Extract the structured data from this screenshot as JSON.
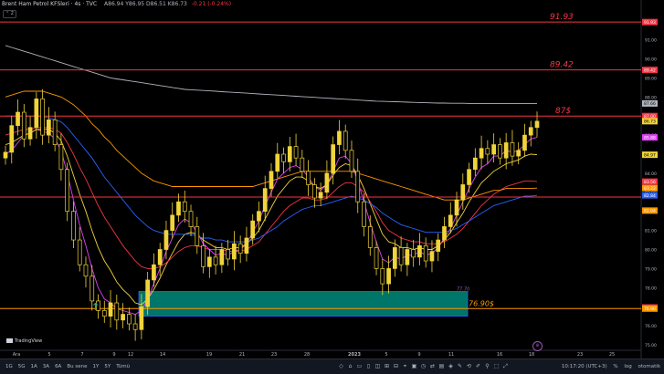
{
  "header": {
    "title": "Brent Ham Petrol KFSleri · 4s · TVC",
    "open": "A86.94",
    "high": "Y86.95",
    "low": "D86.51",
    "close": "K86.73",
    "change": "-0.21 (-0.24%)",
    "collapse_label": "⌃ 2"
  },
  "chart_data": {
    "type": "candlestick",
    "ylim": [
      75.0,
      92.8
    ],
    "price_axis_ticks": [
      "92.00",
      "91.00",
      "90.00",
      "89.00",
      "88.00",
      "87.00",
      "86.00",
      "85.00",
      "84.00",
      "83.00",
      "82.00",
      "81.00",
      "80.00",
      "79.00",
      "78.00",
      "77.00",
      "76.00",
      "75.00"
    ],
    "x_ticks": [
      "Ara",
      "5",
      "7",
      "9",
      "12",
      "14",
      "19",
      "21",
      "23",
      "28",
      "2023",
      "5",
      "9",
      "11",
      "16",
      "18",
      "23",
      "25"
    ],
    "price_tags": [
      {
        "label": "91.93",
        "value": 91.93,
        "color": "#f23645"
      },
      {
        "label": "89.42",
        "value": 89.42,
        "color": "#f23645"
      },
      {
        "label": "87.66",
        "value": 87.66,
        "color": "#b2b5be"
      },
      {
        "label": "87.00",
        "value": 87.0,
        "color": "#f23645"
      },
      {
        "label": "86.73",
        "value": 86.73,
        "color": "#f0d43a"
      },
      {
        "label": "85.88",
        "value": 85.88,
        "color": "#e040fb"
      },
      {
        "label": "84.97",
        "value": 84.97,
        "color": "#f0d43a"
      },
      {
        "label": "83.56",
        "value": 83.56,
        "color": "#f23645"
      },
      {
        "label": "83.22",
        "value": 83.22,
        "color": "#ff9800"
      },
      {
        "label": "82.84",
        "value": 82.84,
        "color": "#2962ff"
      },
      {
        "label": "82.04",
        "value": 82.04,
        "color": "#ff9800"
      },
      {
        "label": "76.96",
        "value": 76.96,
        "color": "#f23645"
      },
      {
        "label": "76.90",
        "value": 76.9,
        "color": "#ff9800"
      }
    ],
    "horizontal_levels": [
      {
        "value": 91.93,
        "color": "#f23645",
        "label": "91.93"
      },
      {
        "value": 89.42,
        "color": "#f23645",
        "label": "89.42"
      },
      {
        "value": 87.0,
        "color": "#f23645",
        "label": "87$"
      },
      {
        "value": 82.75,
        "color": "#f23645",
        "label": ""
      },
      {
        "value": 76.9,
        "color": "#ff9800",
        "label": "76.90$"
      }
    ],
    "zone": {
      "from": 76.5,
      "to": 77.8,
      "label": "77.70",
      "color": "#00897b"
    },
    "closes": [
      85.1,
      86.5,
      87.2,
      85.8,
      86.4,
      87.9,
      86.0,
      86.8,
      85.5,
      84.2,
      82.0,
      80.5,
      79.2,
      78.6,
      77.3,
      76.8,
      76.5,
      77.2,
      76.3,
      76.6,
      76.1,
      75.8,
      77.0,
      78.4,
      79.2,
      80.0,
      81.0,
      81.8,
      82.5,
      82.0,
      81.2,
      80.2,
      79.1,
      79.6,
      79.2,
      80.0,
      79.5,
      80.3,
      79.8,
      80.6,
      81.5,
      82.0,
      83.2,
      84.1,
      85.0,
      84.6,
      85.4,
      84.8,
      84.1,
      83.4,
      82.7,
      83.0,
      84.0,
      85.5,
      86.2,
      85.2,
      84.1,
      82.5,
      81.2,
      80.1,
      79.0,
      78.2,
      79.0,
      80.1,
      79.2,
      80.0,
      79.6,
      80.2,
      79.4,
      79.9,
      80.5,
      81.2,
      81.8,
      82.6,
      83.4,
      84.2,
      84.8,
      85.3,
      85.0,
      85.5,
      84.8,
      85.6,
      84.9,
      85.2,
      86.0,
      86.4,
      86.73
    ],
    "emas": [
      {
        "name": "",
        "color": "#e040fb",
        "values": [
          85.0,
          85.2,
          85.6,
          86.0,
          86.1,
          86.3,
          86.2,
          86.1,
          85.8,
          85.2,
          84.0,
          82.6,
          81.3,
          80.2,
          79.0,
          78.0,
          77.4,
          77.2,
          76.9,
          76.8,
          76.7,
          76.6,
          76.8,
          77.4,
          78.2,
          79.0,
          79.9,
          80.6,
          81.3,
          81.6,
          81.4,
          80.9,
          80.3,
          80.0,
          79.7,
          79.8,
          79.7,
          79.9,
          80.0,
          80.3,
          80.9,
          81.5,
          82.3,
          83.0,
          83.7,
          84.0,
          84.3,
          84.4,
          84.2,
          83.8,
          83.3,
          83.1,
          83.4,
          84.1,
          84.8,
          84.9,
          84.5,
          83.6,
          82.5,
          81.4,
          80.4,
          79.5,
          79.3,
          79.6,
          79.5,
          79.7,
          79.7,
          79.9,
          79.7,
          79.8,
          80.1,
          80.6,
          81.1,
          81.8,
          82.5,
          83.2,
          83.8,
          84.3,
          84.5,
          84.9,
          84.9,
          85.2,
          85.1,
          85.2,
          85.5,
          85.8,
          85.88
        ]
      },
      {
        "name": "",
        "color": "#f0d43a",
        "values": [
          85.5,
          85.6,
          85.8,
          86.0,
          86.1,
          86.3,
          86.3,
          86.3,
          86.1,
          85.7,
          84.9,
          83.9,
          82.9,
          82.0,
          81.0,
          80.1,
          79.4,
          78.9,
          78.3,
          77.9,
          77.6,
          77.2,
          77.1,
          77.4,
          77.9,
          78.5,
          79.2,
          79.8,
          80.4,
          80.8,
          80.9,
          80.8,
          80.5,
          80.3,
          80.1,
          80.1,
          80.0,
          80.1,
          80.1,
          80.3,
          80.6,
          81.0,
          81.6,
          82.2,
          82.8,
          83.2,
          83.6,
          83.8,
          83.8,
          83.6,
          83.3,
          83.2,
          83.4,
          83.9,
          84.3,
          84.5,
          84.4,
          83.9,
          83.2,
          82.4,
          81.6,
          80.8,
          80.4,
          80.3,
          80.1,
          80.1,
          80.0,
          80.1,
          80.0,
          80.0,
          80.2,
          80.5,
          80.9,
          81.4,
          81.9,
          82.5,
          83.0,
          83.5,
          83.8,
          84.1,
          84.3,
          84.5,
          84.6,
          84.7,
          84.9,
          85.0,
          84.97
        ]
      },
      {
        "name": "",
        "color": "#f23645",
        "values": [
          86.0,
          86.1,
          86.2,
          86.3,
          86.3,
          86.4,
          86.4,
          86.4,
          86.3,
          86.1,
          85.6,
          85.0,
          84.3,
          83.7,
          83.0,
          82.3,
          81.7,
          81.2,
          80.7,
          80.2,
          79.8,
          79.4,
          79.1,
          79.0,
          79.0,
          79.1,
          79.3,
          79.6,
          79.9,
          80.1,
          80.2,
          80.2,
          80.1,
          80.0,
          80.0,
          80.0,
          79.9,
          79.9,
          79.9,
          80.0,
          80.2,
          80.4,
          80.8,
          81.2,
          81.6,
          82.0,
          82.3,
          82.5,
          82.7,
          82.7,
          82.6,
          82.6,
          82.7,
          83.0,
          83.3,
          83.5,
          83.5,
          83.3,
          83.0,
          82.5,
          82.0,
          81.4,
          81.0,
          80.8,
          80.6,
          80.5,
          80.4,
          80.4,
          80.3,
          80.3,
          80.3,
          80.4,
          80.6,
          80.8,
          81.1,
          81.5,
          81.9,
          82.3,
          82.6,
          82.9,
          83.1,
          83.3,
          83.4,
          83.5,
          83.6,
          83.6,
          83.56
        ]
      },
      {
        "name": "",
        "color": "#2962ff",
        "values": [
          87.0,
          87.0,
          87.0,
          87.0,
          87.0,
          87.0,
          87.0,
          86.9,
          86.8,
          86.7,
          86.4,
          86.0,
          85.6,
          85.2,
          84.8,
          84.3,
          83.8,
          83.4,
          83.0,
          82.6,
          82.2,
          81.8,
          81.5,
          81.2,
          81.0,
          80.9,
          80.8,
          80.8,
          80.8,
          80.8,
          80.8,
          80.7,
          80.6,
          80.6,
          80.5,
          80.5,
          80.4,
          80.4,
          80.4,
          80.4,
          80.5,
          80.6,
          80.8,
          81.0,
          81.2,
          81.5,
          81.7,
          81.9,
          82.1,
          82.2,
          82.3,
          82.3,
          82.4,
          82.5,
          82.6,
          82.7,
          82.8,
          82.7,
          82.6,
          82.4,
          82.2,
          81.9,
          81.7,
          81.5,
          81.3,
          81.2,
          81.1,
          81.0,
          80.9,
          80.9,
          80.9,
          80.9,
          81.0,
          81.1,
          81.3,
          81.5,
          81.7,
          81.9,
          82.1,
          82.3,
          82.4,
          82.5,
          82.6,
          82.7,
          82.8,
          82.8,
          82.84
        ]
      },
      {
        "name": "",
        "color": "#ff9800",
        "values": [
          88.0,
          88.1,
          88.2,
          88.3,
          88.3,
          88.3,
          88.3,
          88.2,
          88.1,
          88.0,
          87.8,
          87.6,
          87.3,
          87.0,
          86.6,
          86.3,
          85.9,
          85.6,
          85.2,
          84.9,
          84.6,
          84.3,
          84.0,
          83.8,
          83.6,
          83.5,
          83.4,
          83.3,
          83.3,
          83.3,
          83.3,
          83.3,
          83.3,
          83.3,
          83.3,
          83.3,
          83.3,
          83.3,
          83.3,
          83.3,
          83.3,
          83.4,
          83.5,
          83.6,
          83.7,
          83.8,
          83.9,
          84.0,
          84.1,
          84.1,
          84.1,
          84.1,
          84.1,
          84.1,
          84.1,
          84.1,
          84.1,
          84.0,
          83.9,
          83.8,
          83.7,
          83.6,
          83.5,
          83.4,
          83.3,
          83.2,
          83.1,
          83.0,
          82.9,
          82.8,
          82.7,
          82.6,
          82.6,
          82.6,
          82.6,
          82.7,
          82.8,
          82.9,
          83.0,
          83.1,
          83.1,
          83.2,
          83.2,
          83.2,
          83.2,
          83.2,
          83.22
        ]
      },
      {
        "name": "",
        "color": "#b2b5be",
        "values": [
          90.7,
          90.6,
          90.5,
          90.4,
          90.3,
          90.2,
          90.1,
          90.0,
          89.9,
          89.8,
          89.7,
          89.6,
          89.5,
          89.4,
          89.3,
          89.2,
          89.1,
          89.0,
          88.95,
          88.9,
          88.85,
          88.8,
          88.75,
          88.7,
          88.65,
          88.6,
          88.55,
          88.5,
          88.45,
          88.4,
          88.38,
          88.36,
          88.34,
          88.32,
          88.3,
          88.28,
          88.26,
          88.24,
          88.22,
          88.2,
          88.18,
          88.16,
          88.14,
          88.12,
          88.1,
          88.08,
          88.06,
          88.04,
          88.02,
          88.0,
          87.98,
          87.96,
          87.94,
          87.92,
          87.9,
          87.88,
          87.86,
          87.84,
          87.82,
          87.8,
          87.78,
          87.77,
          87.76,
          87.75,
          87.74,
          87.73,
          87.72,
          87.71,
          87.7,
          87.69,
          87.68,
          87.68,
          87.67,
          87.67,
          87.67,
          87.66,
          87.66,
          87.66,
          87.66,
          87.66,
          87.66,
          87.66,
          87.66,
          87.66,
          87.66,
          87.66,
          87.66
        ]
      }
    ]
  },
  "annotations": {
    "up_arrow": "↑"
  },
  "watermark": "TradingView",
  "timeframes": [
    "1G",
    "5G",
    "1A",
    "3A",
    "6A",
    "Bu sene",
    "1Y",
    "5Y",
    "Tümü"
  ],
  "toolbar_icons": [
    "◇",
    "⌂",
    "▭",
    "▯",
    "◫",
    "⊞",
    "⊟",
    "⌖",
    "▣",
    "◷",
    "⇄",
    "▤",
    "◈",
    "✎",
    "⟲",
    "✐",
    "⚲",
    "⬚",
    "⤢"
  ],
  "footer": {
    "time": "10:17:20 (UTC+3)",
    "percent": "%",
    "log": "log",
    "auto": "otomatik"
  },
  "goto_last": "⊕"
}
